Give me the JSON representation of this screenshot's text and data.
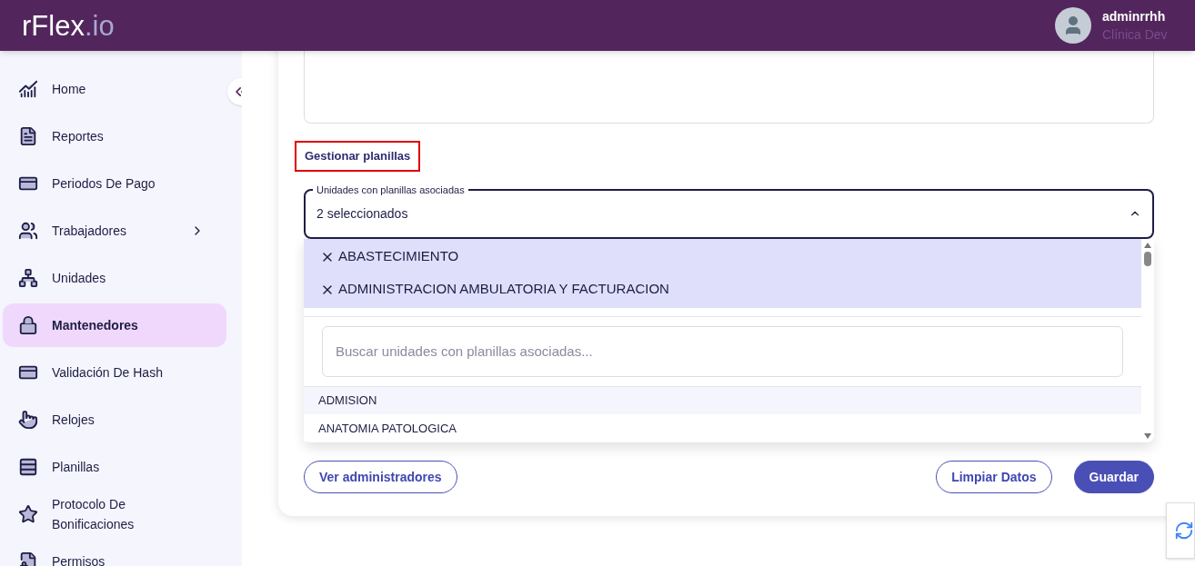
{
  "header": {
    "logo_main": "rFlex",
    "logo_suffix": ".io",
    "user": {
      "name": "adminrrhh",
      "org": "Clínica Dev"
    }
  },
  "sidebar": {
    "items": [
      {
        "label": "Home",
        "selected": false,
        "has_submenu": false
      },
      {
        "label": "Reportes",
        "selected": false,
        "has_submenu": false
      },
      {
        "label": "Periodos De Pago",
        "selected": false,
        "has_submenu": false
      },
      {
        "label": "Trabajadores",
        "selected": false,
        "has_submenu": true
      },
      {
        "label": "Unidades",
        "selected": false,
        "has_submenu": false
      },
      {
        "label": "Mantenedores",
        "selected": true,
        "has_submenu": false
      },
      {
        "label": "Validación De Hash",
        "selected": false,
        "has_submenu": false
      },
      {
        "label": "Relojes",
        "selected": false,
        "has_submenu": false
      },
      {
        "label": "Planillas",
        "selected": false,
        "has_submenu": false
      },
      {
        "label": "Protocolo De Bonificaciones",
        "selected": false,
        "has_submenu": false
      },
      {
        "label": "Permisos",
        "selected": false,
        "has_submenu": false
      }
    ]
  },
  "section": {
    "title": "Gestionar planillas",
    "select": {
      "label": "Unidades con planillas asociadas",
      "value": "2 seleccionados",
      "expanded": true,
      "chips": [
        "ABASTECIMIENTO",
        "ADMINISTRACION AMBULATORIA Y FACTURACION"
      ],
      "search": {
        "placeholder": "Buscar unidades con planillas asociadas..."
      },
      "options": [
        {
          "label": "ADMISION",
          "selected": true
        },
        {
          "label": "ANATOMIA PATOLOGICA",
          "selected": false
        }
      ]
    }
  },
  "buttons": [
    {
      "label": "Ver administradores",
      "kind": "outline"
    },
    {
      "label": "Limpiar Datos",
      "kind": "outline"
    },
    {
      "label": "Guardar",
      "kind": "primary"
    }
  ]
}
